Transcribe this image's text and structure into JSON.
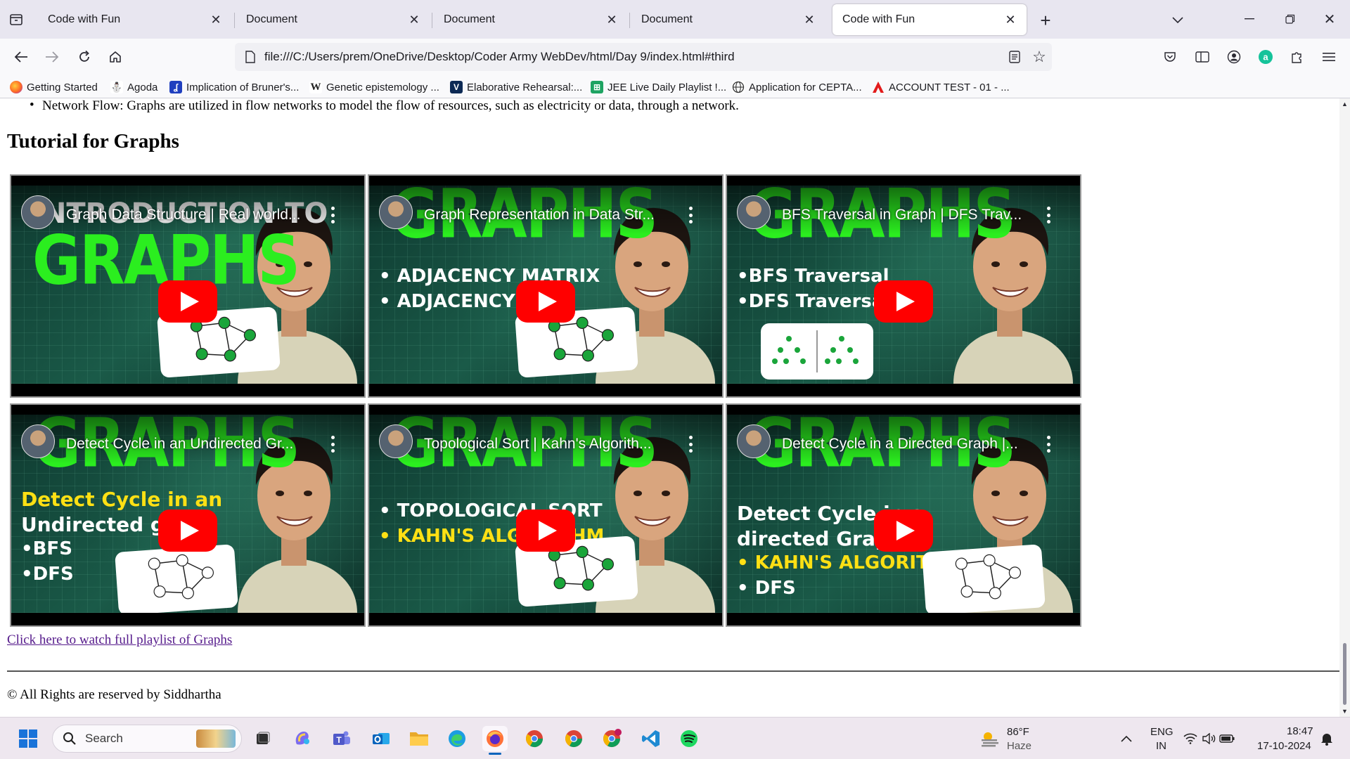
{
  "tabs": [
    {
      "label": "Code with Fun",
      "active": false
    },
    {
      "label": "Document",
      "active": false
    },
    {
      "label": "Document",
      "active": false
    },
    {
      "label": "Document",
      "active": false
    },
    {
      "label": "Code with Fun",
      "active": true
    }
  ],
  "address": {
    "url": "file:///C:/Users/prem/OneDrive/Desktop/Coder Army WebDev/html/Day 9/index.html#third"
  },
  "bookmarks": [
    {
      "label": "Getting Started",
      "icon": "firefox-icon"
    },
    {
      "label": "Agoda",
      "icon": "agoda-icon"
    },
    {
      "label": "Implication of Bruner's...",
      "icon": "document-icon"
    },
    {
      "label": "Genetic epistemology ...",
      "icon": "wikipedia-icon"
    },
    {
      "label": "Elaborative Rehearsal:...",
      "icon": "site-icon"
    },
    {
      "label": "JEE Live Daily Playlist !...",
      "icon": "sheets-icon"
    },
    {
      "label": "Application for CEPTA...",
      "icon": "globe-icon"
    },
    {
      "label": "ACCOUNT TEST - 01 - ...",
      "icon": "triangle-icon"
    }
  ],
  "page": {
    "bullet": "Network Flow: Graphs are utilized in flow networks to model the flow of resources, such as electricity or data, through a network.",
    "heading": "Tutorial for Graphs",
    "videos": [
      {
        "title": "Graph Data Structure | Real world...",
        "big": "GRAPHS",
        "top": "INTRODUCTION TO",
        "lines": [],
        "card": "graph"
      },
      {
        "title": "Graph Representation in Data Str...",
        "big": "GRAPHS",
        "top": "",
        "lines": [
          "• ADJACENCY MATRIX",
          "• ADJACENCY LIST"
        ],
        "card": "graph"
      },
      {
        "title": "BFS Traversal in Graph | DFS Trav...",
        "big": "GRAPHS",
        "top": "",
        "lines": [
          "•BFS Traversal",
          "•DFS Traversal"
        ],
        "card": "tree"
      },
      {
        "title": "Detect Cycle in an Undirected Gr...",
        "big": "GRAPHS",
        "top": "",
        "lines": [
          "Detect Cycle in an",
          "Undirected graph",
          "•BFS",
          "•DFS"
        ],
        "card": "graph"
      },
      {
        "title": "Topological Sort | Kahn's Algorith...",
        "big": "GRAPHS",
        "top": "",
        "lines": [
          "• TOPOLOGICAL SORT",
          "• KAHN'S ALGORITHM"
        ],
        "card": "graph"
      },
      {
        "title": "Detect Cycle in a Directed Graph |...",
        "big": "GRAPHS",
        "top": "",
        "lines": [
          "Detect Cycle in a",
          "directed Graph",
          "• KAHN'S ALGORITHM",
          "• DFS"
        ],
        "card": "graph"
      }
    ],
    "playlist_link": "Click here to watch full playlist of Graphs",
    "footer": "© All Rights are reserved by Siddhartha"
  },
  "taskbar": {
    "search_placeholder": "Search",
    "weather_temp": "86°F",
    "weather_desc": "Haze",
    "lang_line1": "ENG",
    "lang_line2": "IN",
    "time": "18:47",
    "date": "17-10-2024"
  },
  "colors": {
    "play": "#ff0000",
    "thumb_green": "#2bee1f",
    "link_visited": "#551a8b"
  }
}
